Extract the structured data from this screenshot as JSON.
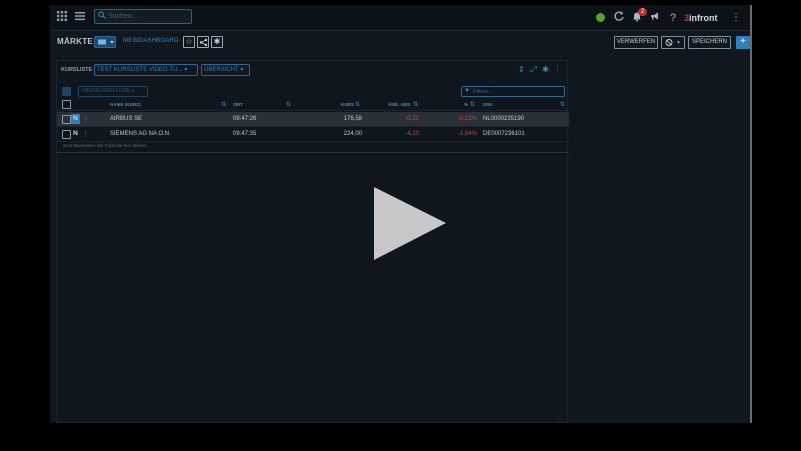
{
  "topbar": {
    "search_placeholder": "Suchen...",
    "notification_count": "2",
    "brand_number": "3",
    "brand_name": "infront",
    "help_label": "?"
  },
  "header": {
    "title": "MÄRKTE",
    "dashboard_link": "MEINDASHBOARD",
    "discard_label": "VERWERFEN",
    "save_label": "SPEICHERN",
    "add_label": "+"
  },
  "widget": {
    "list_label": "KURSLISTE",
    "list_select": "TEST KURSLISTE VIDEO-TU...",
    "view_select": "ÜBERSICHT",
    "filter_placeholder": "Filtern...",
    "add_instrument": "HINZUFÜGEN LISTE",
    "columns": {
      "name": "NAME (KURZ)",
      "time": "ZEIT",
      "price": "KURS",
      "change_abs": "ÄND. ABS.",
      "change_pct": "%",
      "isin": "ISIN"
    },
    "rows": [
      {
        "flag": "N",
        "name": "AIRBUS SE",
        "time": "09:47:26",
        "price": "176,58",
        "change_abs": "-0,22",
        "change_pct": "-0,12%",
        "isin": "NL0000235190"
      },
      {
        "flag": "N",
        "name": "SIEMENS AG NA O.N.",
        "time": "09:47:35",
        "price": "224,00",
        "change_abs": "-4,20",
        "change_pct": "-1,84%",
        "isin": "DE0007236101"
      }
    ],
    "footer_hint": "Zum Bearbeiten der Fußzeile hier klicken."
  },
  "colors": {
    "accent": "#2d80b8",
    "negative": "#d0403a",
    "status_online": "#5aa030",
    "brand_red": "#c0302a"
  },
  "icons": [
    "apps-grid-icon",
    "menu-icon",
    "search-icon",
    "status-dot-icon",
    "refresh-icon",
    "bell-icon",
    "megaphone-icon",
    "help-icon",
    "kebab-icon",
    "star-icon",
    "share-icon",
    "settings-icon",
    "play-icon"
  ]
}
